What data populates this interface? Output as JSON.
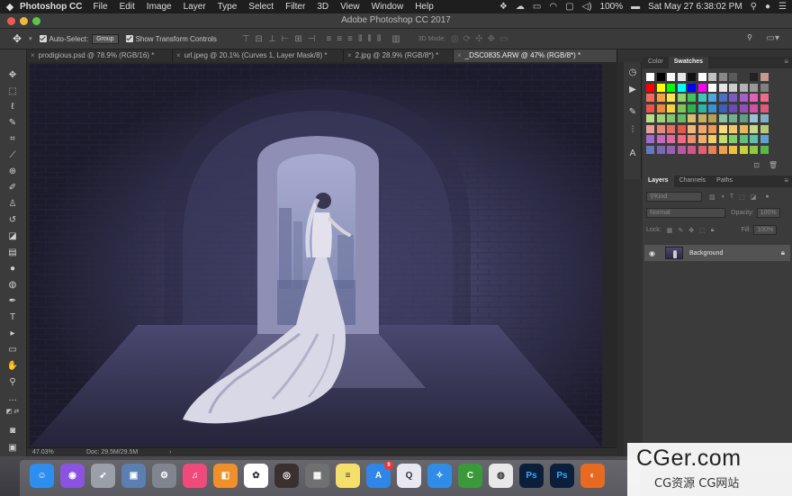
{
  "menubar": {
    "app_name": "Photoshop CC",
    "items": [
      "File",
      "Edit",
      "Image",
      "Layer",
      "Type",
      "Select",
      "Filter",
      "3D",
      "View",
      "Window",
      "Help"
    ],
    "battery": "100%",
    "clock": "Sat May 27  6:38:02 PM"
  },
  "window": {
    "title": "Adobe Photoshop CC 2017"
  },
  "options_bar": {
    "auto_select_label": "Auto-Select:",
    "auto_select_value": "Group",
    "transform_label": "Show Transform Controls",
    "mode_3d_label": "3D Mode:"
  },
  "tabs": [
    {
      "label": "prodigious.psd @ 78.9% (RGB/16) *",
      "active": false
    },
    {
      "label": "url.jpeg @ 20.1% (Curves 1, Layer Mask/8) *",
      "active": false
    },
    {
      "label": "2.jpg @ 28.9% (RGB/8*) *",
      "active": false
    },
    {
      "label": "_DSC0835.ARW @ 47% (RGB/8*) *",
      "active": true
    }
  ],
  "status_bar": {
    "zoom": "47.03%",
    "doc": "Doc: 29.5M/29.5M"
  },
  "swatches_panel": {
    "tabs": [
      {
        "label": "Color",
        "active": false
      },
      {
        "label": "Swatches",
        "active": true
      }
    ],
    "rows": [
      [
        "#ffffff",
        "#000000",
        "#f7f7f7",
        "#e8e8e8",
        "#111111",
        "#ffffff",
        "#c0c0c0",
        "#888888",
        "#5a5a5a",
        "#3a3a3a",
        "#222222",
        "#c59a8c"
      ],
      [
        "#ff0000",
        "#ffff00",
        "#00ff00",
        "#00ffff",
        "#0000ff",
        "#ff00ff",
        "#ffffff",
        "#e6e6e6",
        "#cccccc",
        "#b3b3b3",
        "#999999",
        "#808080"
      ],
      [
        "#f06b5c",
        "#f7a046",
        "#fbe54c",
        "#8fd36c",
        "#3ec45a",
        "#3cc8b4",
        "#4fa7e2",
        "#4c70c9",
        "#7a5bc2",
        "#a65ec9",
        "#e062b6",
        "#ef6b8c"
      ],
      [
        "#e85448",
        "#f08a3c",
        "#f5d43a",
        "#7ec45a",
        "#2db34c",
        "#2cb5a2",
        "#3993d0",
        "#3c5fb8",
        "#6a4bb1",
        "#9550b8",
        "#cf52a5",
        "#de5b7b"
      ],
      [
        "#b8e08a",
        "#9cd47c",
        "#80c870",
        "#64bc64",
        "#d8c070",
        "#c8b060",
        "#b8a050",
        "#8bc0a0",
        "#70b090",
        "#60a080",
        "#9ac0d8",
        "#80b0c8"
      ],
      [
        "#e8a098",
        "#e88878",
        "#e87060",
        "#e85848",
        "#f0b878",
        "#f0a868",
        "#f09858",
        "#f8d878",
        "#f0c868",
        "#e8b858",
        "#c8d888",
        "#b8c878"
      ],
      [
        "#a06ad0",
        "#c06ac0",
        "#e06aa0",
        "#f06a80",
        "#f0906a",
        "#f0b06a",
        "#f0d06a",
        "#c0e06a",
        "#80d06a",
        "#60c080",
        "#60c0b0",
        "#60a0d0"
      ],
      [
        "#6878c0",
        "#7868b8",
        "#9860b0",
        "#b858a0",
        "#d05888",
        "#e06070",
        "#e88058",
        "#f0a048",
        "#f0c040",
        "#c8d040",
        "#90c840",
        "#58b848"
      ]
    ]
  },
  "layers_panel": {
    "tabs": [
      {
        "label": "Layers",
        "active": true
      },
      {
        "label": "Channels",
        "active": false
      },
      {
        "label": "Paths",
        "active": false
      }
    ],
    "filter_kind": "Kind",
    "blend_mode": "Normal",
    "opacity_label": "Opacity:",
    "opacity_value": "100%",
    "lock_label": "Lock:",
    "fill_label": "Fill:",
    "fill_value": "100%",
    "layer_name": "Background"
  },
  "dock": {
    "apps": [
      {
        "name": "Finder",
        "color": "#2e8ef0",
        "glyph": "☺"
      },
      {
        "name": "Siri",
        "color": "#8b54e0",
        "glyph": "◉"
      },
      {
        "name": "Launchpad",
        "color": "#9aa0a8",
        "glyph": "➶"
      },
      {
        "name": "Preview",
        "color": "#5a7fb0",
        "glyph": "▣"
      },
      {
        "name": "System Preferences",
        "color": "#808590",
        "glyph": "⚙"
      },
      {
        "name": "iTunes",
        "color": "#f04a7a",
        "glyph": "♫"
      },
      {
        "name": "iBooks",
        "color": "#f0902a",
        "glyph": "◧"
      },
      {
        "name": "Photos",
        "color": "#ffffff",
        "glyph": "✿"
      },
      {
        "name": "Speaker",
        "color": "#3a3030",
        "glyph": "◎"
      },
      {
        "name": "Calculator",
        "color": "#707070",
        "glyph": "▦"
      },
      {
        "name": "Notes",
        "color": "#f5df6b",
        "glyph": "≡"
      },
      {
        "name": "App Store",
        "color": "#2f86e8",
        "glyph": "A"
      },
      {
        "name": "QuickTime",
        "color": "#e8e8f0",
        "glyph": "Q"
      },
      {
        "name": "Safari",
        "color": "#2f8de8",
        "glyph": "✧"
      },
      {
        "name": "Camtasia",
        "color": "#3a9a3a",
        "glyph": "C"
      },
      {
        "name": "Chrome",
        "color": "#e8e8e8",
        "glyph": "◍"
      },
      {
        "name": "Photoshop",
        "color": "#0c1f3a",
        "glyph": "Ps"
      },
      {
        "name": "Photoshop 2",
        "color": "#0c1f3a",
        "glyph": "Ps"
      },
      {
        "name": "Firefox",
        "color": "#e86a20",
        "glyph": "◐"
      }
    ],
    "badge_count": "9"
  },
  "watermark": {
    "line1": "CGer.com",
    "line2": "CG资源 CG网站"
  }
}
